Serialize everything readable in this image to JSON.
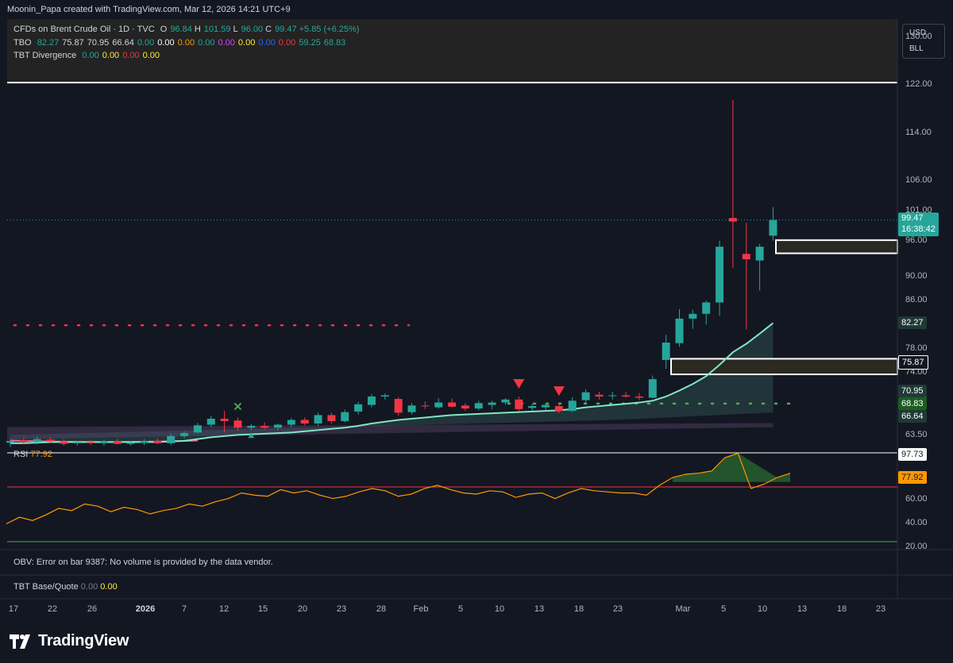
{
  "header": {
    "credit": "Moonin_Papa created with TradingView.com, Mar 12, 2026 14:21 UTC+9"
  },
  "legend": {
    "symbol": "CFDs on Brent Crude Oil · 1D · TVC",
    "ohlc": [
      {
        "k": "O",
        "v": "96.84"
      },
      {
        "k": "H",
        "v": "101.59"
      },
      {
        "k": "L",
        "v": "96.00"
      },
      {
        "k": "C",
        "v": "99.47"
      },
      {
        "k": "",
        "v": "+5.85 (+6.25%)"
      }
    ],
    "tbo_name": "TBO",
    "tbo_values": [
      {
        "v": "82.27",
        "c": "#26a69a"
      },
      {
        "v": "75.87",
        "c": "#d1d4dc"
      },
      {
        "v": "70.95",
        "c": "#d1d4dc"
      },
      {
        "v": "66.64",
        "c": "#d1d4dc"
      },
      {
        "v": "0.00",
        "c": "#26a69a"
      },
      {
        "v": "0.00",
        "c": "#ffffff"
      },
      {
        "v": "0.00",
        "c": "#ff9800"
      },
      {
        "v": "0.00",
        "c": "#26a69a"
      },
      {
        "v": "0.00",
        "c": "#e040fb"
      },
      {
        "v": "0.00",
        "c": "#ffeb3b"
      },
      {
        "v": "0.00",
        "c": "#2962ff"
      },
      {
        "v": "0.00",
        "c": "#f23645"
      },
      {
        "v": "59.25",
        "c": "#26a69a"
      },
      {
        "v": "68.83",
        "c": "#26a69a"
      }
    ],
    "div_name": "TBT Divergence",
    "div_values": [
      {
        "v": "0.00",
        "c": "#26a69a"
      },
      {
        "v": "0.00",
        "c": "#ffeb3b"
      },
      {
        "v": "0.00",
        "c": "#f23645"
      },
      {
        "v": "0.00",
        "c": "#ffeb3b"
      }
    ],
    "currency": "USD",
    "unit": "BLL"
  },
  "price_axis": {
    "ticks": [
      "130.00",
      "122.00",
      "114.00",
      "106.00",
      "101.00",
      "96.00",
      "90.00",
      "86.00",
      "78.00",
      "74.00",
      "70.00",
      "63.50"
    ]
  },
  "price_labels": [
    {
      "text": "99.47",
      "sub": "16:38:42",
      "bg": "#26a69a",
      "fg": "#ffffff",
      "price": 99.47
    },
    {
      "text": "82.27",
      "bg": "#1e3a36",
      "fg": "#ffffff",
      "price": 82.27
    },
    {
      "text": "75.87",
      "bg": "#131722",
      "fg": "#ffffff",
      "price": 75.87,
      "border": "#ffffff"
    },
    {
      "text": "70.95",
      "bg": "#1e3a36",
      "fg": "#ffffff",
      "price": 70.95
    },
    {
      "text": "68.83",
      "bg": "#1b5e20",
      "fg": "#ffffff",
      "price": 68.83
    },
    {
      "text": "66.64",
      "bg": "#1e3a36",
      "fg": "#ffffff",
      "price": 66.64
    }
  ],
  "rsi": {
    "label": "RSI",
    "value": "77.92",
    "ticks": [
      "60.00",
      "40.00",
      "20.00"
    ],
    "labels": [
      {
        "text": "97.73",
        "bg": "#ffffff",
        "fg": "#131722"
      },
      {
        "text": "77.92",
        "bg": "#ff9800",
        "fg": "#131722"
      }
    ]
  },
  "obv": {
    "text": "OBV: Error on bar 9387: No volume is provided by the data vendor."
  },
  "tbt_bq": {
    "name": "TBT Base/Quote",
    "v1": "0.00",
    "v2": "0.00"
  },
  "time_axis": {
    "ticks": [
      {
        "t": "17"
      },
      {
        "t": "22"
      },
      {
        "t": "26"
      },
      {
        "t": "2026",
        "bold": true
      },
      {
        "t": "7"
      },
      {
        "t": "12"
      },
      {
        "t": "15"
      },
      {
        "t": "20"
      },
      {
        "t": "23"
      },
      {
        "t": "28"
      },
      {
        "t": "Feb"
      },
      {
        "t": "5"
      },
      {
        "t": "10"
      },
      {
        "t": "13"
      },
      {
        "t": "18"
      },
      {
        "t": "23"
      },
      {
        "t": "Mar"
      },
      {
        "t": "5"
      },
      {
        "t": "10"
      },
      {
        "t": "13"
      },
      {
        "t": "18"
      },
      {
        "t": "23"
      }
    ]
  },
  "brand": "TradingView",
  "colors": {
    "up": "#26a69a",
    "down": "#f23645",
    "rsi": "#ff9800",
    "ma": "#81e6c4",
    "bg": "#131722"
  },
  "chart_data": {
    "type": "candlestick",
    "symbol": "CFDs on Brent Crude Oil",
    "interval": "1D",
    "candles": [
      {
        "o": 62.3,
        "h": 62.9,
        "l": 61.6,
        "c": 62.6
      },
      {
        "o": 62.7,
        "h": 63.1,
        "l": 62.0,
        "c": 62.4
      },
      {
        "o": 62.4,
        "h": 63.3,
        "l": 62.0,
        "c": 62.9
      },
      {
        "o": 62.8,
        "h": 63.2,
        "l": 62.2,
        "c": 62.5
      },
      {
        "o": 62.5,
        "h": 62.9,
        "l": 61.8,
        "c": 62.1
      },
      {
        "o": 62.2,
        "h": 62.6,
        "l": 61.8,
        "c": 62.4
      },
      {
        "o": 62.4,
        "h": 62.7,
        "l": 61.9,
        "c": 62.2
      },
      {
        "o": 62.2,
        "h": 62.8,
        "l": 61.8,
        "c": 62.5
      },
      {
        "o": 62.5,
        "h": 62.9,
        "l": 62.0,
        "c": 62.1
      },
      {
        "o": 62.1,
        "h": 62.6,
        "l": 61.8,
        "c": 62.3
      },
      {
        "o": 62.3,
        "h": 62.9,
        "l": 61.9,
        "c": 62.6
      },
      {
        "o": 62.6,
        "h": 63.0,
        "l": 62.0,
        "c": 62.2
      },
      {
        "o": 62.2,
        "h": 63.8,
        "l": 61.9,
        "c": 63.4
      },
      {
        "o": 63.4,
        "h": 64.2,
        "l": 63.0,
        "c": 63.9
      },
      {
        "o": 64.0,
        "h": 65.6,
        "l": 63.8,
        "c": 65.2
      },
      {
        "o": 65.3,
        "h": 66.8,
        "l": 64.9,
        "c": 66.3
      },
      {
        "o": 66.3,
        "h": 67.6,
        "l": 64.0,
        "c": 65.9
      },
      {
        "o": 66.0,
        "h": 66.5,
        "l": 64.3,
        "c": 64.8
      },
      {
        "o": 64.8,
        "h": 65.4,
        "l": 64.4,
        "c": 65.1
      },
      {
        "o": 65.1,
        "h": 65.7,
        "l": 64.5,
        "c": 64.8
      },
      {
        "o": 64.8,
        "h": 65.5,
        "l": 64.4,
        "c": 65.3
      },
      {
        "o": 65.3,
        "h": 66.4,
        "l": 64.9,
        "c": 66.1
      },
      {
        "o": 66.1,
        "h": 66.5,
        "l": 65.2,
        "c": 65.5
      },
      {
        "o": 65.5,
        "h": 67.3,
        "l": 65.1,
        "c": 66.9
      },
      {
        "o": 66.9,
        "h": 67.3,
        "l": 65.5,
        "c": 65.9
      },
      {
        "o": 65.9,
        "h": 67.8,
        "l": 65.7,
        "c": 67.4
      },
      {
        "o": 67.5,
        "h": 69.1,
        "l": 67.0,
        "c": 68.7
      },
      {
        "o": 68.6,
        "h": 70.4,
        "l": 68.2,
        "c": 70.0
      },
      {
        "o": 70.0,
        "h": 70.5,
        "l": 69.5,
        "c": 70.2
      },
      {
        "o": 69.6,
        "h": 69.9,
        "l": 66.8,
        "c": 67.3
      },
      {
        "o": 67.4,
        "h": 68.9,
        "l": 67.0,
        "c": 68.5
      },
      {
        "o": 68.5,
        "h": 69.2,
        "l": 67.9,
        "c": 68.4
      },
      {
        "o": 68.2,
        "h": 69.7,
        "l": 68.0,
        "c": 69.0
      },
      {
        "o": 69.0,
        "h": 69.7,
        "l": 68.2,
        "c": 68.3
      },
      {
        "o": 68.5,
        "h": 68.9,
        "l": 67.6,
        "c": 68.0
      },
      {
        "o": 68.0,
        "h": 69.3,
        "l": 67.7,
        "c": 68.9
      },
      {
        "o": 68.6,
        "h": 69.3,
        "l": 67.9,
        "c": 69.0
      },
      {
        "o": 69.0,
        "h": 69.7,
        "l": 68.6,
        "c": 69.5
      },
      {
        "o": 69.5,
        "h": 70.0,
        "l": 67.5,
        "c": 67.9
      },
      {
        "o": 68.1,
        "h": 68.8,
        "l": 67.6,
        "c": 68.4
      },
      {
        "o": 68.2,
        "h": 68.8,
        "l": 67.7,
        "c": 68.6
      },
      {
        "o": 68.4,
        "h": 68.8,
        "l": 67.2,
        "c": 67.6
      },
      {
        "o": 67.6,
        "h": 69.9,
        "l": 67.4,
        "c": 69.3
      },
      {
        "o": 69.4,
        "h": 71.2,
        "l": 68.9,
        "c": 70.7
      },
      {
        "o": 70.3,
        "h": 70.8,
        "l": 69.5,
        "c": 70.0
      },
      {
        "o": 70.2,
        "h": 70.8,
        "l": 69.5,
        "c": 70.2
      },
      {
        "o": 70.2,
        "h": 70.8,
        "l": 69.8,
        "c": 70.0
      },
      {
        "o": 70.0,
        "h": 70.6,
        "l": 69.4,
        "c": 69.8
      },
      {
        "o": 69.8,
        "h": 73.5,
        "l": 69.7,
        "c": 72.9
      },
      {
        "o": 76.1,
        "h": 80.3,
        "l": 74.6,
        "c": 79.0
      },
      {
        "o": 78.9,
        "h": 84.6,
        "l": 78.3,
        "c": 83.0
      },
      {
        "o": 83.0,
        "h": 84.5,
        "l": 81.3,
        "c": 83.8
      },
      {
        "o": 83.8,
        "h": 86.0,
        "l": 82.0,
        "c": 85.7
      },
      {
        "o": 85.7,
        "h": 96.0,
        "l": 83.5,
        "c": 95.0
      },
      {
        "o": 99.8,
        "h": 119.5,
        "l": 91.5,
        "c": 99.2
      },
      {
        "o": 93.8,
        "h": 99.0,
        "l": 81.2,
        "c": 92.9
      },
      {
        "o": 92.7,
        "h": 95.5,
        "l": 87.7,
        "c": 95.0
      },
      {
        "o": 96.84,
        "h": 101.59,
        "l": 96.0,
        "c": 99.47
      }
    ],
    "tbo_fast": [
      62.2,
      62.2,
      62.3,
      62.4,
      62.4,
      62.4,
      62.4,
      62.4,
      62.4,
      62.4,
      62.4,
      62.4,
      62.5,
      62.6,
      62.9,
      63.2,
      63.4,
      63.6,
      63.7,
      63.8,
      63.9,
      64.0,
      64.2,
      64.4,
      64.6,
      64.8,
      65.1,
      65.5,
      65.8,
      66.1,
      66.3,
      66.5,
      66.7,
      66.9,
      67.0,
      67.1,
      67.2,
      67.3,
      67.4,
      67.5,
      67.6,
      67.7,
      67.9,
      68.2,
      68.4,
      68.6,
      68.8,
      69.0,
      69.3,
      70.0,
      71.0,
      72.1,
      73.4,
      75.3,
      77.4,
      78.8,
      80.5,
      82.27
    ],
    "levels": [
      {
        "name": "resistance",
        "price": 122.4
      },
      {
        "name": "red-dotted",
        "price": 81.9
      },
      {
        "name": "green-dotted",
        "price": 68.83
      }
    ],
    "zones": [
      {
        "name": "zone-upper",
        "top": 96.1,
        "bottom": 93.9
      },
      {
        "name": "zone-lower",
        "top": 76.3,
        "bottom": 73.7
      }
    ],
    "signals": [
      {
        "type": "sell-triangle",
        "index": 38
      },
      {
        "type": "sell-triangle",
        "index": 41
      },
      {
        "type": "cross",
        "index": 17
      },
      {
        "type": "buy-triangle",
        "index": 18
      }
    ],
    "rsi": [
      32,
      38,
      35,
      40,
      46,
      44,
      50,
      48,
      43,
      47,
      45,
      41,
      44,
      46,
      50,
      48,
      52,
      55,
      60,
      58,
      57,
      63,
      60,
      62,
      58,
      55,
      57,
      61,
      64,
      62,
      57,
      59,
      64,
      67,
      63,
      60,
      59,
      62,
      61,
      56,
      59,
      60,
      55,
      60,
      64,
      62,
      61,
      60,
      60,
      58,
      67,
      74,
      77,
      78,
      80,
      92,
      96,
      64,
      68,
      74,
      77.92
    ],
    "rsi_range": [
      0,
      100
    ],
    "y_range": [
      61.0,
      133.0
    ]
  }
}
